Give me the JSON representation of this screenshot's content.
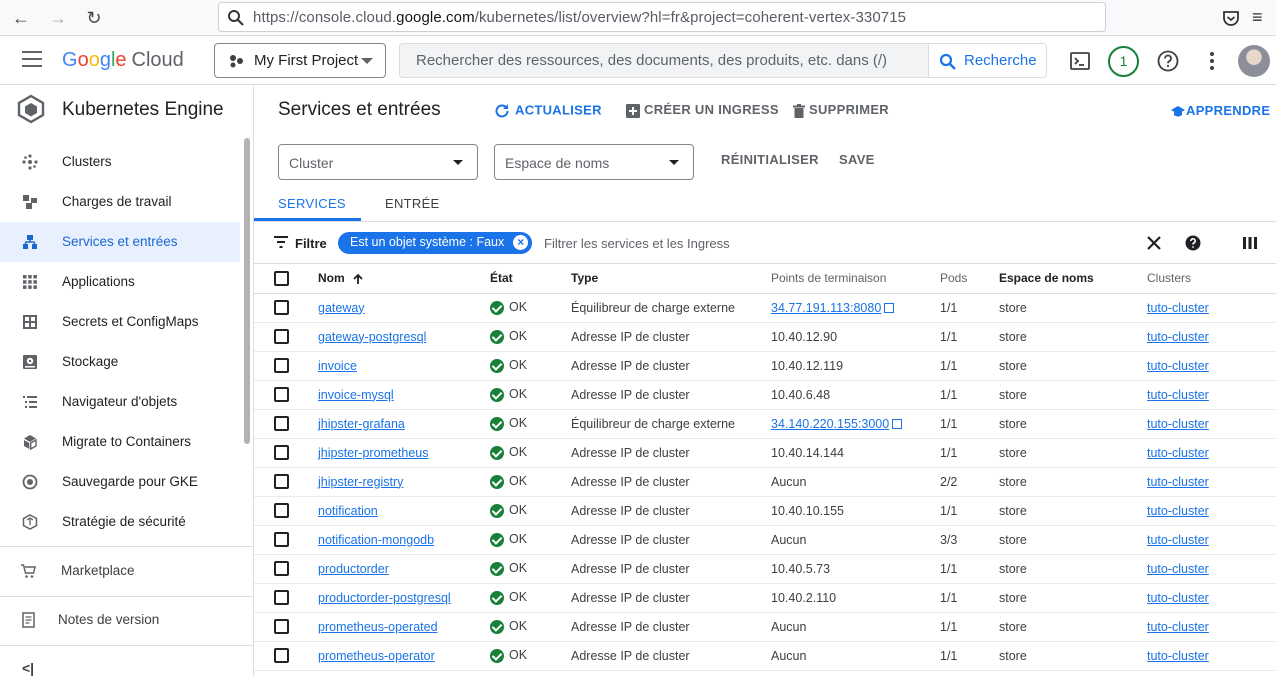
{
  "browser": {
    "url_prefix": "https://console.cloud.",
    "url_domain": "google.com",
    "url_suffix": "/kubernetes/list/overview?hl=fr&project=coherent-vertex-330715"
  },
  "header": {
    "logo_letters": [
      "G",
      "o",
      "o",
      "g",
      "l",
      "e"
    ],
    "logo_cloud": "Cloud",
    "project": "My First Project",
    "search_placeholder": "Rechercher des ressources, des documents, des produits, etc. dans (/)",
    "search_button": "Recherche",
    "notification_count": "1"
  },
  "sidebar": {
    "product_title": "Kubernetes Engine",
    "items": [
      {
        "label": "Clusters",
        "icon": "clusters-icon"
      },
      {
        "label": "Charges de travail",
        "icon": "workloads-icon"
      },
      {
        "label": "Services et entrées",
        "icon": "services-icon"
      },
      {
        "label": "Applications",
        "icon": "applications-icon"
      },
      {
        "label": "Secrets et ConfigMaps",
        "icon": "secrets-icon"
      },
      {
        "label": "Stockage",
        "icon": "storage-icon"
      },
      {
        "label": "Navigateur d'objets",
        "icon": "object-browser-icon"
      },
      {
        "label": "Migrate to Containers",
        "icon": "migrate-icon"
      },
      {
        "label": "Sauvegarde pour GKE",
        "icon": "backup-icon"
      },
      {
        "label": "Stratégie de sécurité",
        "icon": "security-icon"
      }
    ],
    "marketplace": "Marketplace",
    "release_notes": "Notes de version",
    "collapse_glyph": "<|"
  },
  "main": {
    "title": "Services et entrées",
    "actions": {
      "refresh": "ACTUALISER",
      "create_ingress": "CRÉER UN INGRESS",
      "delete": "SUPPRIMER",
      "learn": "APPRENDRE"
    },
    "filters": {
      "cluster": "Cluster",
      "namespace": "Espace de noms",
      "reset": "RÉINITIALISER",
      "save": "SAVE"
    },
    "tabs": [
      "SERVICES",
      "ENTRÉE"
    ],
    "filter_label": "Filtre",
    "filter_chip": "Est un objet système : Faux",
    "filter_placeholder": "Filtrer les services et les Ingress",
    "columns": [
      "Nom",
      "État",
      "Type",
      "Points de terminaison",
      "Pods",
      "Espace de noms",
      "Clusters"
    ],
    "rows": [
      {
        "name": "gateway",
        "status": "OK",
        "type": "Équilibreur de charge externe",
        "endpoint": "34.77.191.113:8080",
        "endpoint_link": true,
        "pods": "1/1",
        "namespace": "store",
        "cluster": "tuto-cluster"
      },
      {
        "name": "gateway-postgresql",
        "status": "OK",
        "type": "Adresse IP de cluster",
        "endpoint": "10.40.12.90",
        "endpoint_link": false,
        "pods": "1/1",
        "namespace": "store",
        "cluster": "tuto-cluster"
      },
      {
        "name": "invoice",
        "status": "OK",
        "type": "Adresse IP de cluster",
        "endpoint": "10.40.12.119",
        "endpoint_link": false,
        "pods": "1/1",
        "namespace": "store",
        "cluster": "tuto-cluster"
      },
      {
        "name": "invoice-mysql",
        "status": "OK",
        "type": "Adresse IP de cluster",
        "endpoint": "10.40.6.48",
        "endpoint_link": false,
        "pods": "1/1",
        "namespace": "store",
        "cluster": "tuto-cluster"
      },
      {
        "name": "jhipster-grafana",
        "status": "OK",
        "type": "Équilibreur de charge externe",
        "endpoint": "34.140.220.155:3000",
        "endpoint_link": true,
        "pods": "1/1",
        "namespace": "store",
        "cluster": "tuto-cluster"
      },
      {
        "name": "jhipster-prometheus",
        "status": "OK",
        "type": "Adresse IP de cluster",
        "endpoint": "10.40.14.144",
        "endpoint_link": false,
        "pods": "1/1",
        "namespace": "store",
        "cluster": "tuto-cluster"
      },
      {
        "name": "jhipster-registry",
        "status": "OK",
        "type": "Adresse IP de cluster",
        "endpoint": "Aucun",
        "endpoint_link": false,
        "pods": "2/2",
        "namespace": "store",
        "cluster": "tuto-cluster"
      },
      {
        "name": "notification",
        "status": "OK",
        "type": "Adresse IP de cluster",
        "endpoint": "10.40.10.155",
        "endpoint_link": false,
        "pods": "1/1",
        "namespace": "store",
        "cluster": "tuto-cluster"
      },
      {
        "name": "notification-mongodb",
        "status": "OK",
        "type": "Adresse IP de cluster",
        "endpoint": "Aucun",
        "endpoint_link": false,
        "pods": "3/3",
        "namespace": "store",
        "cluster": "tuto-cluster"
      },
      {
        "name": "productorder",
        "status": "OK",
        "type": "Adresse IP de cluster",
        "endpoint": "10.40.5.73",
        "endpoint_link": false,
        "pods": "1/1",
        "namespace": "store",
        "cluster": "tuto-cluster"
      },
      {
        "name": "productorder-postgresql",
        "status": "OK",
        "type": "Adresse IP de cluster",
        "endpoint": "10.40.2.110",
        "endpoint_link": false,
        "pods": "1/1",
        "namespace": "store",
        "cluster": "tuto-cluster"
      },
      {
        "name": "prometheus-operated",
        "status": "OK",
        "type": "Adresse IP de cluster",
        "endpoint": "Aucun",
        "endpoint_link": false,
        "pods": "1/1",
        "namespace": "store",
        "cluster": "tuto-cluster"
      },
      {
        "name": "prometheus-operator",
        "status": "OK",
        "type": "Adresse IP de cluster",
        "endpoint": "Aucun",
        "endpoint_link": false,
        "pods": "1/1",
        "namespace": "store",
        "cluster": "tuto-cluster"
      }
    ]
  },
  "colors": {
    "accent": "#1a73e8",
    "ok": "#188038",
    "active_bg": "#e8f0fe"
  }
}
